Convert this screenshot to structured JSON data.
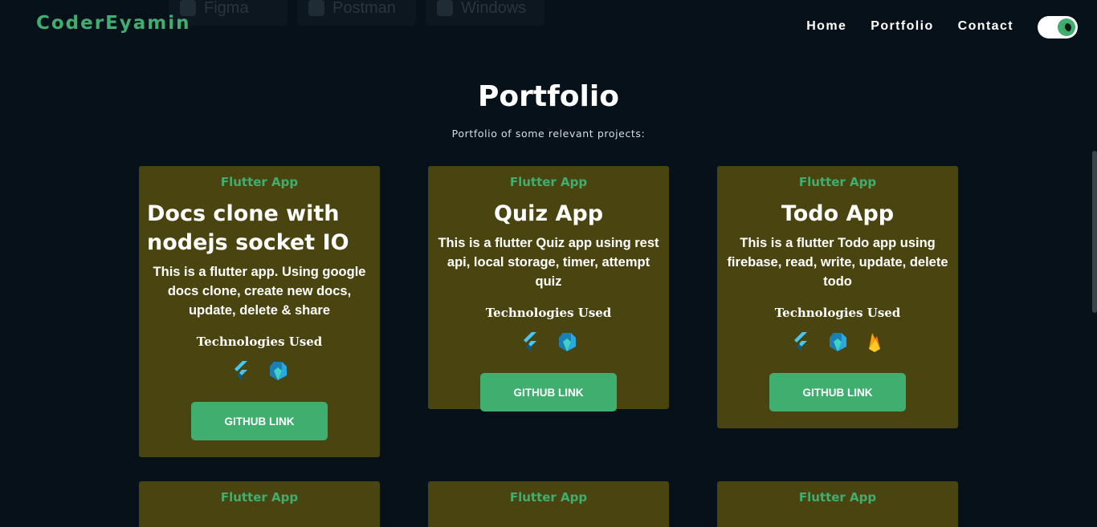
{
  "ghost_chips": [
    "Figma",
    "Postman",
    "Windows"
  ],
  "nav": {
    "logo": "CoderEyamin",
    "links": [
      "Home",
      "Portfolio",
      "Contact"
    ]
  },
  "section": {
    "title": "Portfolio",
    "subtitle": "Portfolio of some relevant projects:"
  },
  "cards": [
    {
      "tag": "Flutter App",
      "title": "Docs clone with nodejs socket IO",
      "description": "This is a flutter app. Using google docs clone, create new docs, update, delete & share",
      "tech_label": "Technologies Used",
      "tech": [
        "flutter-icon",
        "dart-icon"
      ],
      "button": "GITHUB LINK"
    },
    {
      "tag": "Flutter App",
      "title": "Quiz App",
      "description": "This is a flutter Quiz app using rest api, local storage, timer, attempt quiz",
      "tech_label": "Technologies Used",
      "tech": [
        "flutter-icon",
        "dart-icon"
      ],
      "button": "GITHUB LINK"
    },
    {
      "tag": "Flutter App",
      "title": "Todo App",
      "description": "This is a flutter Todo app using firebase, read, write, update, delete todo",
      "tech_label": "Technologies Used",
      "tech": [
        "flutter-icon",
        "dart-icon",
        "firebase-icon"
      ],
      "button": "GITHUB LINK"
    },
    {
      "tag": "Flutter App"
    },
    {
      "tag": "Flutter App"
    },
    {
      "tag": "Flutter App"
    }
  ],
  "colors": {
    "background": "#07111a",
    "accent": "#3fae6f",
    "card": "#4a4510"
  }
}
